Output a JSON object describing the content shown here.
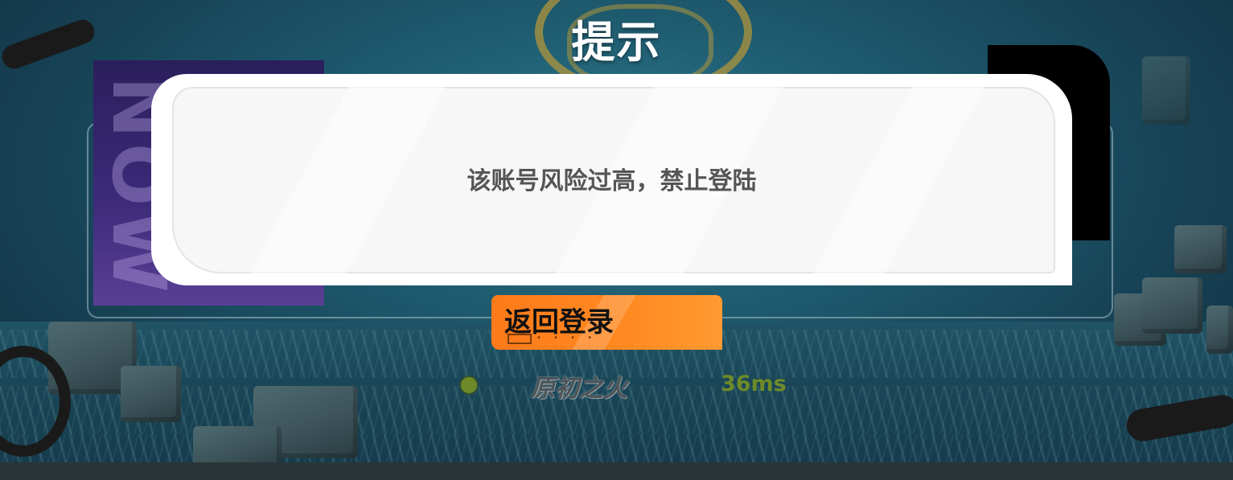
{
  "dialog": {
    "title": "提示",
    "message": "该账号风险过高，禁止登陆"
  },
  "actions": {
    "return_label": "返回登录"
  },
  "server": {
    "name": "原初之火",
    "ping": "36ms",
    "status_color": "#6e8a28"
  },
  "background": {
    "panel_text": "NOW"
  },
  "colors": {
    "accent_orange": "#ff8a22",
    "dialog_bg": "#ffffff",
    "message_text": "#555555",
    "title_text": "#ffffff"
  }
}
